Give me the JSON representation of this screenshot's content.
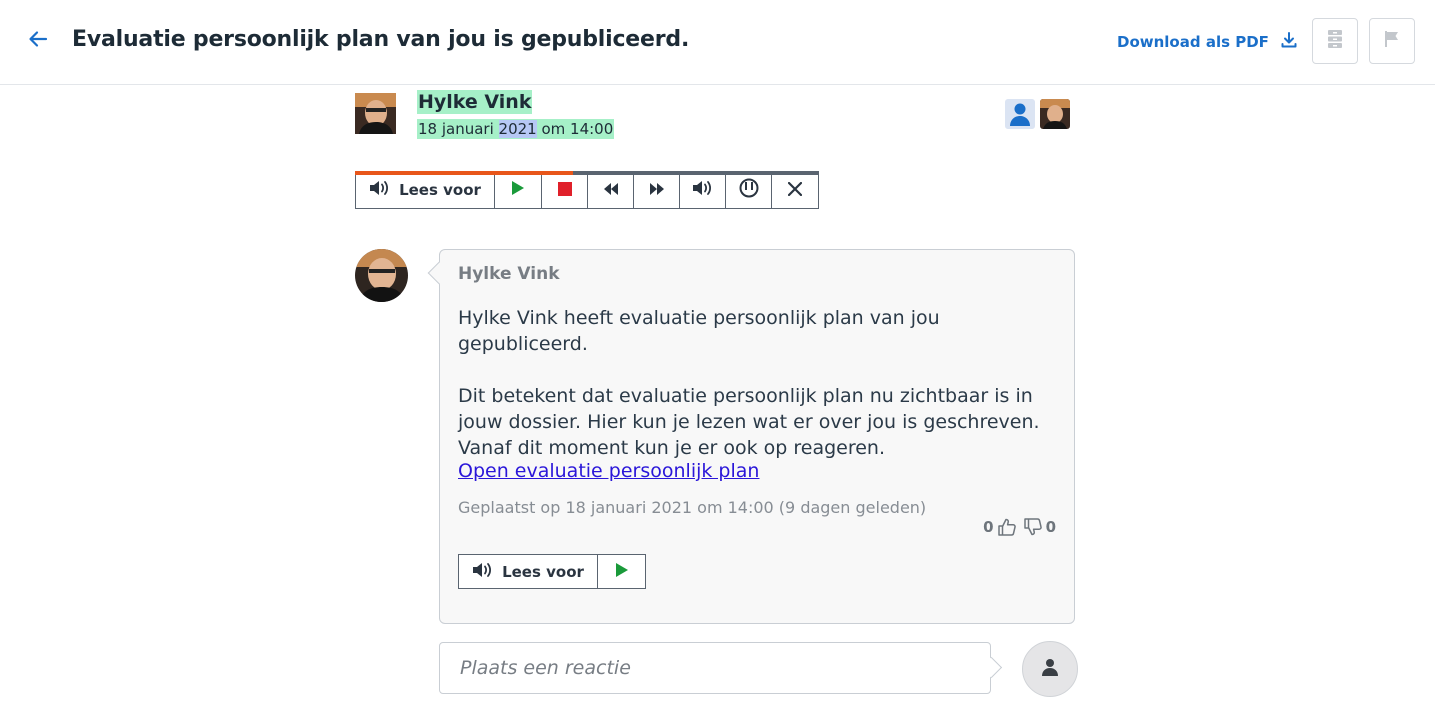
{
  "header": {
    "back_icon": "arrow-left-icon",
    "title": "Evaluatie persoonlijk plan van jou is gepubliceerd.",
    "pdf_label": "Download als PDF",
    "pdf_icon": "download-icon",
    "button1_icon": "archive-icon",
    "button2_icon": "flag-icon",
    "accent_color": "#1b6fc9"
  },
  "author": {
    "name": "Hylke Vink",
    "date_prefix": "18 januari ",
    "date_year": "2021",
    "date_suffix": " om 14:00",
    "highlight_color": "#a6f0c8"
  },
  "readspeaker": {
    "label": "Lees voor",
    "progress": 0.47,
    "progress_color": "#e8561a",
    "buttons": [
      "play-icon",
      "stop-icon",
      "rewind-icon",
      "forward-icon",
      "volume-icon",
      "settings-icon",
      "close-icon"
    ]
  },
  "message": {
    "sender": "Hylke Vink",
    "paragraph1": "Hylke Vink heeft evaluatie persoonlijk plan van jou gepubliceerd.",
    "paragraph2": "Dit betekent dat evaluatie persoonlijk plan nu zichtbaar is in jouw dossier. Hier kun je lezen wat er over jou is geschreven. Vanaf dit moment kun je er ook op reageren.",
    "link": "Open evaluatie persoonlijk plan",
    "meta": "Geplaatst op 18 januari 2021 om 14:00 (9 dagen geleden)",
    "likes": "0",
    "dislikes": "0",
    "readspeaker_label": "Lees voor"
  },
  "comment": {
    "placeholder": "Plaats een reactie"
  }
}
